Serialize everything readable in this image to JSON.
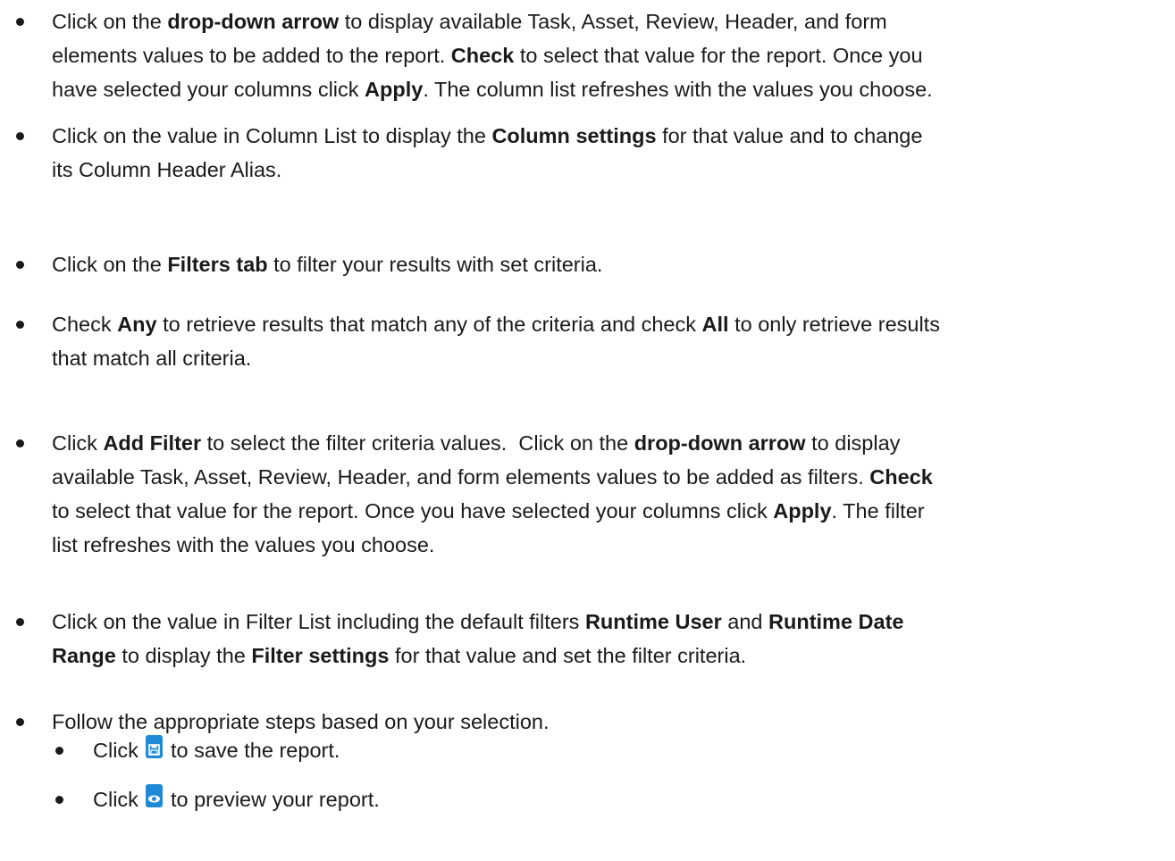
{
  "bullets": [
    {
      "segments": [
        {
          "t": "Click on the "
        },
        {
          "t": "drop-down arrow",
          "b": true
        },
        {
          "t": " to display available Task, Asset, Review, Header, and form elements values to be added to the report. "
        },
        {
          "t": "Check",
          "b": true
        },
        {
          "t": " to select that value for the report. Once you have selected your columns click "
        },
        {
          "t": "Apply",
          "b": true
        },
        {
          "t": ". The column list refreshes with the values you choose."
        }
      ],
      "lines": [
        [
          {
            "t": "Click on the "
          },
          {
            "t": "drop-down arrow",
            "b": true
          },
          {
            "t": " to display available Task, Asset, Review, Header, and form"
          }
        ],
        [
          {
            "t": "elements values to be added to the report. "
          },
          {
            "t": "Check",
            "b": true
          },
          {
            "t": " to select that value for the report. Once you"
          }
        ],
        [
          {
            "t": "have selected your columns click "
          },
          {
            "t": "Apply",
            "b": true
          },
          {
            "t": ". The column list refreshes with the values you choose."
          }
        ]
      ]
    },
    {
      "lines": [
        [
          {
            "t": "Click on the value in Column List to display the "
          },
          {
            "t": "Column settings",
            "b": true
          },
          {
            "t": " for that value and to change"
          }
        ],
        [
          {
            "t": "its Column Header Alias."
          }
        ]
      ]
    },
    {
      "lines": [
        [
          {
            "t": "Click on the "
          },
          {
            "t": "Filters tab",
            "b": true
          },
          {
            "t": " to filter your results with set criteria."
          }
        ]
      ]
    },
    {
      "lines": [
        [
          {
            "t": "Check "
          },
          {
            "t": "Any",
            "b": true
          },
          {
            "t": " to retrieve results that match any of the criteria and check "
          },
          {
            "t": "All",
            "b": true
          },
          {
            "t": " to only retrieve results"
          }
        ],
        [
          {
            "t": "that match all criteria."
          }
        ]
      ]
    },
    {
      "lines": [
        [
          {
            "t": "Click "
          },
          {
            "t": "Add Filter",
            "b": true
          },
          {
            "t": " to select the filter criteria values.  Click on the "
          },
          {
            "t": "drop-down arrow",
            "b": true
          },
          {
            "t": " to display"
          }
        ],
        [
          {
            "t": "available Task, Asset, Review, Header, and form elements values to be added as filters. "
          },
          {
            "t": "Check",
            "b": true
          }
        ],
        [
          {
            "t": "to select that value for the report. Once you have selected your columns click "
          },
          {
            "t": "Apply",
            "b": true
          },
          {
            "t": ". The filter"
          }
        ],
        [
          {
            "t": "list refreshes with the values you choose."
          }
        ]
      ]
    },
    {
      "lines": [
        [
          {
            "t": "Click on the value in Filter List including the default filters "
          },
          {
            "t": "Runtime User",
            "b": true
          },
          {
            "t": " and "
          },
          {
            "t": "Runtime Date",
            "b": true
          }
        ],
        [
          {
            "t": "Range",
            "b": true
          },
          {
            "t": " to display the "
          },
          {
            "t": "Filter settings",
            "b": true
          },
          {
            "t": " for that value and set the filter criteria."
          }
        ]
      ]
    },
    {
      "lines": [
        [
          {
            "t": "Follow the appropriate steps based on your selection."
          }
        ]
      ]
    }
  ],
  "sub_bullets": [
    {
      "before": "Click",
      "icon": "save-icon",
      "after": "to save the report."
    },
    {
      "before": "Click",
      "icon": "eye-icon",
      "after": "to preview your report."
    }
  ],
  "colors": {
    "text": "#1a1a1a",
    "icon_blue": "#1e8ad6"
  }
}
